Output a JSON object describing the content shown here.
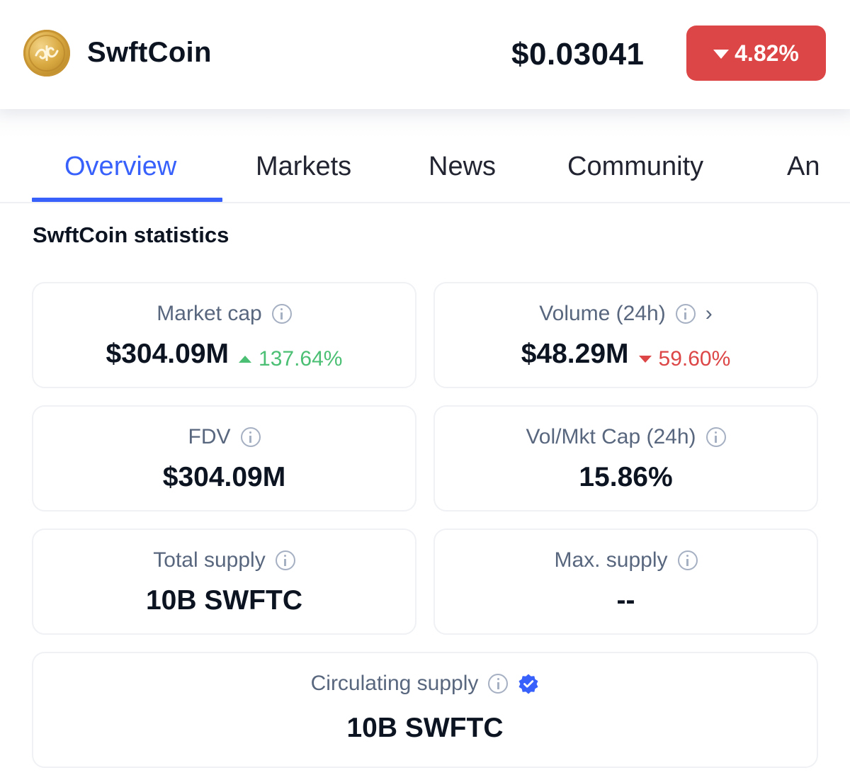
{
  "header": {
    "coin_name": "SwftCoin",
    "price": "$0.03041",
    "change_pct": "4.82%",
    "change_color": "#dd4646",
    "logo_icon": "swftcoin-logo-icon"
  },
  "tabs": [
    {
      "label": "Overview",
      "active": true
    },
    {
      "label": "Markets",
      "active": false
    },
    {
      "label": "News",
      "active": false
    },
    {
      "label": "Community",
      "active": false
    },
    {
      "label": "An",
      "active": false
    }
  ],
  "stats": {
    "title": "SwftCoin statistics",
    "market_cap": {
      "label": "Market cap",
      "value": "$304.09M",
      "change": "137.64%",
      "direction": "up"
    },
    "volume": {
      "label": "Volume (24h)",
      "value": "$48.29M",
      "change": "59.60%",
      "direction": "down"
    },
    "fdv": {
      "label": "FDV",
      "value": "$304.09M"
    },
    "vol_mkt_cap": {
      "label": "Vol/Mkt Cap (24h)",
      "value": "15.86%"
    },
    "total_supply": {
      "label": "Total supply",
      "value": "10B SWFTC"
    },
    "max_supply": {
      "label": "Max. supply",
      "value": "--"
    },
    "circulating_supply": {
      "label": "Circulating supply",
      "value": "10B SWFTC",
      "verified": true
    }
  },
  "colors": {
    "accent": "#3861fb",
    "positive": "#4bbf73",
    "negative": "#dd4646",
    "muted_text": "#58667e"
  }
}
